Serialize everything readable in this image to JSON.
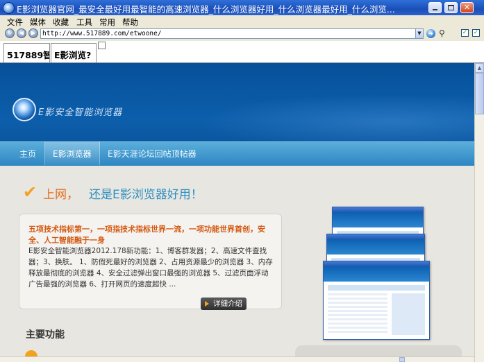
{
  "window": {
    "title": "E影浏览器官网_最安全最好用最智能的高速浏览器_什么浏览器好用_什么浏览器最好用_什么浏览..."
  },
  "menu": [
    "文件",
    "媒体",
    "收藏",
    "工具",
    "常用",
    "帮助"
  ],
  "address": {
    "url": "http://www.517889.com/etwoone/"
  },
  "tabs": [
    {
      "label": "517889智"
    },
    {
      "label": "E影浏览?"
    }
  ],
  "site": {
    "logo_text": "E影安全智能浏览器",
    "nav": [
      "主页",
      "E影浏览器",
      "E影天涯论坛回帖顶帖器"
    ],
    "nav_active": "E影浏览器",
    "hero": {
      "part_a": "上网，",
      "part_b": "还是E影浏览器好用！"
    },
    "card": {
      "title": "五项技术指标第一，一项指技术指标世界一流，一项功能世界首创，安全、人工智能融于一身",
      "body": "E影安全智能浏览器2012.178新功能：1、博客群发器；2、高速文件查找器；3、换肤。 1、防假死最好的浏览器 2、占用资源最少的浏览器 3、内存释放最彻底的浏览器 4、安全过滤弹出窗口最强的浏览器 5、过滤页面浮动广告最强的浏览器 6、打开网页的速度超快 ...",
      "button": "详细介绍"
    },
    "section_title": "主要功能"
  },
  "colors": {
    "titlebar": "#1b4fb8",
    "banner": "#0c5eab",
    "accent_orange": "#e46a17",
    "accent_blue": "#2a8fc0"
  }
}
